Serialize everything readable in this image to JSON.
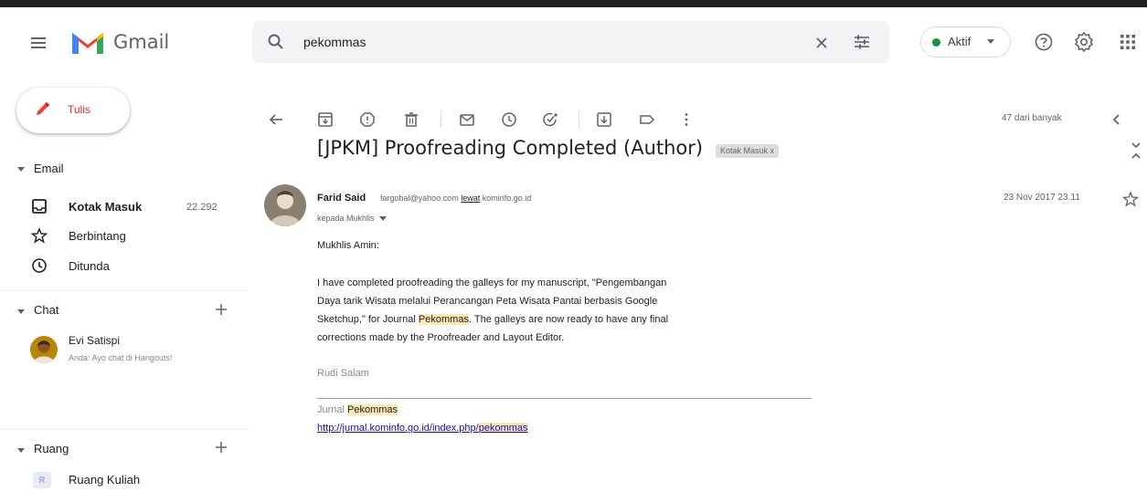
{
  "header": {
    "product_name": "Gmail",
    "search": {
      "query": "pekommas"
    },
    "status": {
      "label": "Aktif",
      "color": "#1e8e3e"
    }
  },
  "sidebar": {
    "compose_label": "Tulis",
    "email_section": {
      "label": "Email",
      "items": [
        {
          "label": "Kotak Masuk",
          "count": "22.292",
          "icon": "inbox-icon"
        },
        {
          "label": "Berbintang",
          "icon": "star-icon"
        },
        {
          "label": "Ditunda",
          "icon": "snooze-icon"
        }
      ]
    },
    "chat_section": {
      "label": "Chat",
      "contacts": [
        {
          "name": "Evi Satispi",
          "preview": "Anda: Ayo chat di Hangouts!"
        }
      ]
    },
    "rooms_section": {
      "label": "Ruang",
      "rooms": [
        {
          "badge": "R",
          "name": "Ruang Kuliah"
        }
      ]
    }
  },
  "toolbar": {
    "pager": "47 dari banyak"
  },
  "message": {
    "subject": "[JPKM] Proofreading Completed (Author)",
    "label_chip": "Kotak Masuk x",
    "sender": {
      "name": "Farid Said",
      "email": "fargobal@yahoo.com",
      "via_word": "lewat",
      "via_domain": "kominfo.go.id",
      "to_line": "kepada Mukhlis"
    },
    "date": "23 Nov 2017 23.11",
    "greeting": "Mukhlis Amin:",
    "body": {
      "line1": "I have completed proofreading the galleys for my manuscript, \"Pengembangan",
      "line2": "Daya tarik Wisata melalui Perancangan Peta Wisata Pantai berbasis Google",
      "line3_pre": "Sketchup,\" for Journal ",
      "line3_highlight": "Pekommas",
      "line3_post": ". The galleys are now ready to have any final",
      "line4": "corrections made by the Proofreader and Layout Editor."
    },
    "signature_name": "Rudi Salam",
    "journal_pre": "Jurnal ",
    "journal_highlight": "Pekommas",
    "link_pre": "http://jurnal.kominfo.go.id/index.php/",
    "link_highlight": "pekommas"
  },
  "colors": {
    "accent_red": "#d93025",
    "highlight": "#fce8b2",
    "link": "#1a0dab"
  }
}
